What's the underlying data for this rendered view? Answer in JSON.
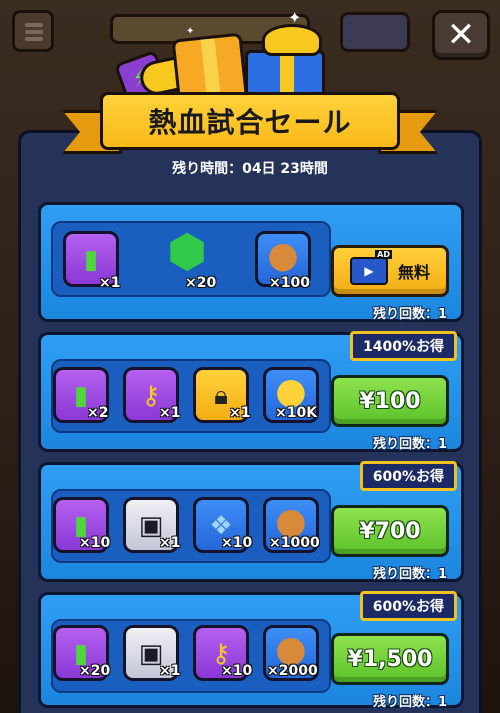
{
  "title": "熱血試合セール",
  "timer": "残り時間：04日 23時間",
  "close_label": "✕",
  "offers": [
    {
      "tag": "",
      "button": "無料",
      "ad_label": "AD",
      "remaining": "残り回数：1",
      "items": [
        {
          "icon": "energy-bottle-icon",
          "qty": "×1"
        },
        {
          "icon": "green-gem-icon",
          "qty": "×20"
        },
        {
          "icon": "shiba-coin-icon",
          "qty": "×100"
        }
      ]
    },
    {
      "tag": "1400%お得",
      "button": "¥100",
      "remaining": "残り回数：1",
      "items": [
        {
          "icon": "energy-bottle-icon",
          "qty": "×2"
        },
        {
          "icon": "key-icon",
          "qty": "×1"
        },
        {
          "icon": "lock-icon",
          "qty": "×1"
        },
        {
          "icon": "gold-coin-icon",
          "qty": "×10K"
        }
      ]
    },
    {
      "tag": "600%お得",
      "button": "¥700",
      "remaining": "残り回数：1",
      "items": [
        {
          "icon": "energy-bottle-icon",
          "qty": "×10"
        },
        {
          "icon": "robot-box-icon",
          "qty": "×1"
        },
        {
          "icon": "blue-gift-icon",
          "qty": "×10"
        },
        {
          "icon": "shiba-coin-icon",
          "qty": "×1000"
        }
      ]
    },
    {
      "tag": "600%お得",
      "button": "¥1,500",
      "remaining": "残り回数：1",
      "items": [
        {
          "icon": "energy-bottle-icon",
          "qty": "×20"
        },
        {
          "icon": "robot-box-icon",
          "qty": "×1"
        },
        {
          "icon": "key-icon",
          "qty": "×10"
        },
        {
          "icon": "shiba-coin-icon",
          "qty": "×2000"
        }
      ]
    }
  ],
  "colors": {
    "title_banner": "#f9b91a",
    "offer_bg": "#1c86df",
    "buy_button": "#5cc22a",
    "tag_border": "#f2c21f"
  }
}
